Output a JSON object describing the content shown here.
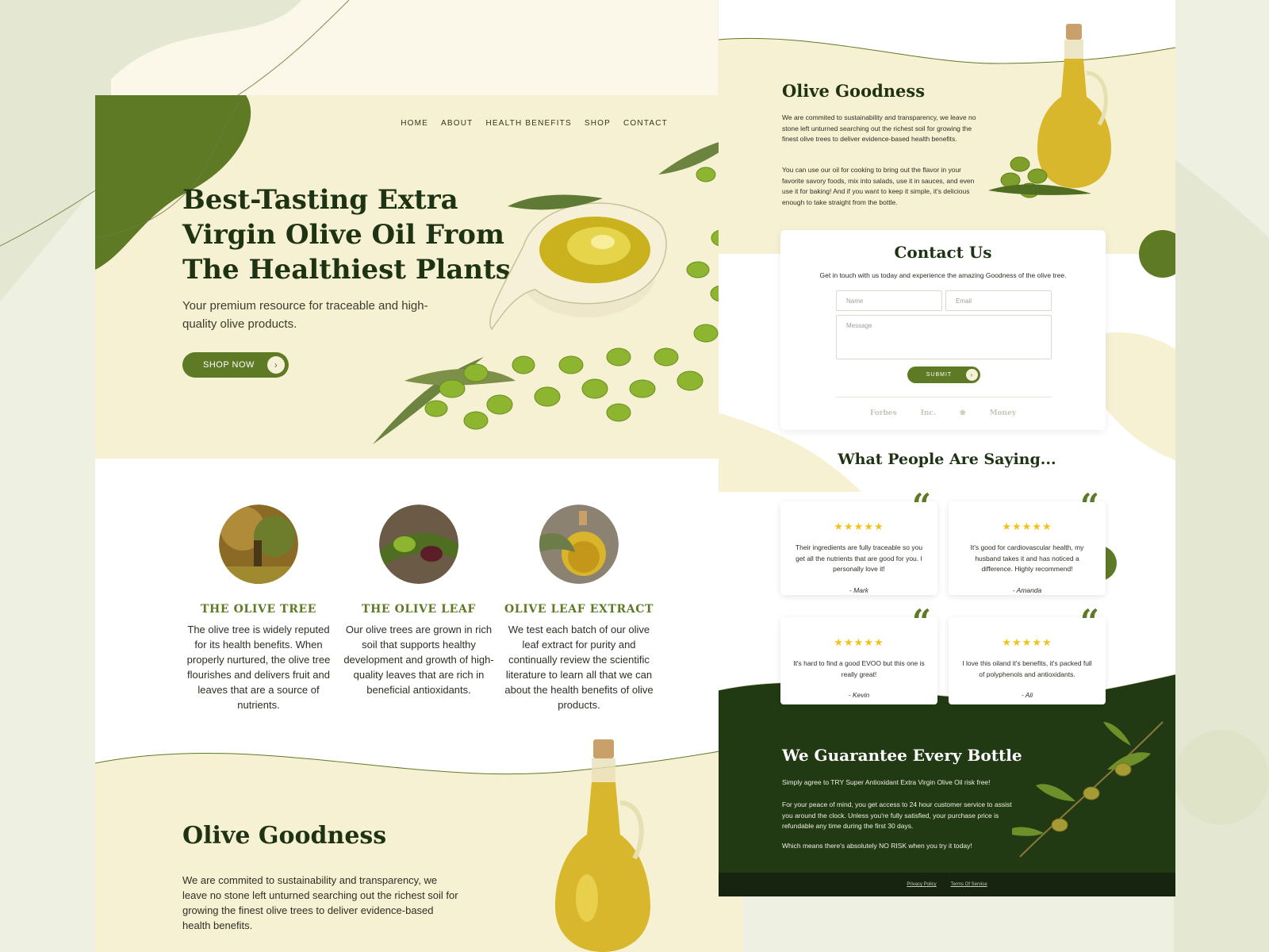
{
  "nav": [
    "HOME",
    "ABOUT",
    "HEALTH BENEFITS",
    "SHOP",
    "CONTACT"
  ],
  "hero": {
    "title": "Best-Tasting Extra Virgin Olive Oil From The Healthiest Plants",
    "subtitle": "Your premium resource for traceable and high-quality olive products.",
    "cta": "SHOP NOW"
  },
  "features": [
    {
      "title": "THE OLIVE TREE",
      "text": "The olive tree is widely reputed for its health benefits. When properly nurtured, the olive tree flourishes and delivers fruit and leaves that are a source of nutrients."
    },
    {
      "title": "THE OLIVE LEAF",
      "text": "Our olive trees are grown in rich soil that supports healthy development and growth of high-quality leaves that are rich in beneficial antioxidants."
    },
    {
      "title": "OLIVE LEAF EXTRACT",
      "text": "We test each batch of our olive leaf extract for purity and continually review the scientific literature to learn all that we can about the health benefits of olive products."
    }
  ],
  "goodness": {
    "title": "Olive Goodness",
    "p1": "We are commited to sustainability and transparency, we leave no stone left unturned searching out the richest soil for growing the finest olive trees to deliver evidence-based health benefits.",
    "p2": "You can use our oil for cooking to bring out the flavor in your favorite savory foods, mix into salads, use it in sauces, and even use it for baking! And if you want to keep it simple, it's delicious enough to take straight from the bottle."
  },
  "contact": {
    "title": "Contact Us",
    "subtitle": "Get in touch with us today and experience the amazing Goodness of the olive tree.",
    "name_placeholder": "Name",
    "email_placeholder": "Email",
    "message_placeholder": "Message",
    "submit": "SUBMIT",
    "press": [
      "Forbes",
      "Inc.",
      "❀",
      "Money"
    ]
  },
  "testimonials": {
    "title": "What People Are Saying...",
    "stars": "★★★★★",
    "quote_mark": "“",
    "items": [
      {
        "text": "Their ingredients are fully traceable so you get all the nutrients that are good for you. I personally love it!",
        "author": "- Mark"
      },
      {
        "text": "It's good for cardiovascular health, my husband takes it and has noticed a difference. Highly recommend!",
        "author": "- Amanda"
      },
      {
        "text": "It's hard to find a good EVOO but this one is really great!",
        "author": "- Kevin"
      },
      {
        "text": "I love this oiland it's benefits, it's packed full of polyphenols and antioxidants.",
        "author": "- Ali"
      }
    ]
  },
  "guarantee": {
    "title": "We Guarantee Every Bottle",
    "p1": "Simply agree to TRY Super Antioxidant Extra Virgin Olive Oil risk free!",
    "p2": "For your peace of mind, you get access to 24 hour customer service to assist you around the clock. Unless you're fully satisfied, your purchase price is refundable any time during the first 30 days.",
    "p3": "Which means there's absolutely NO RISK when you try it today!"
  },
  "footer": {
    "privacy": "Privacy Policy",
    "terms": "Terms Of Service"
  },
  "colors": {
    "accent": "#5e7a25",
    "dark_green": "#1e3314",
    "cream": "#f7f1d3",
    "star": "#f2c21b",
    "footer_bg": "#223a14"
  }
}
